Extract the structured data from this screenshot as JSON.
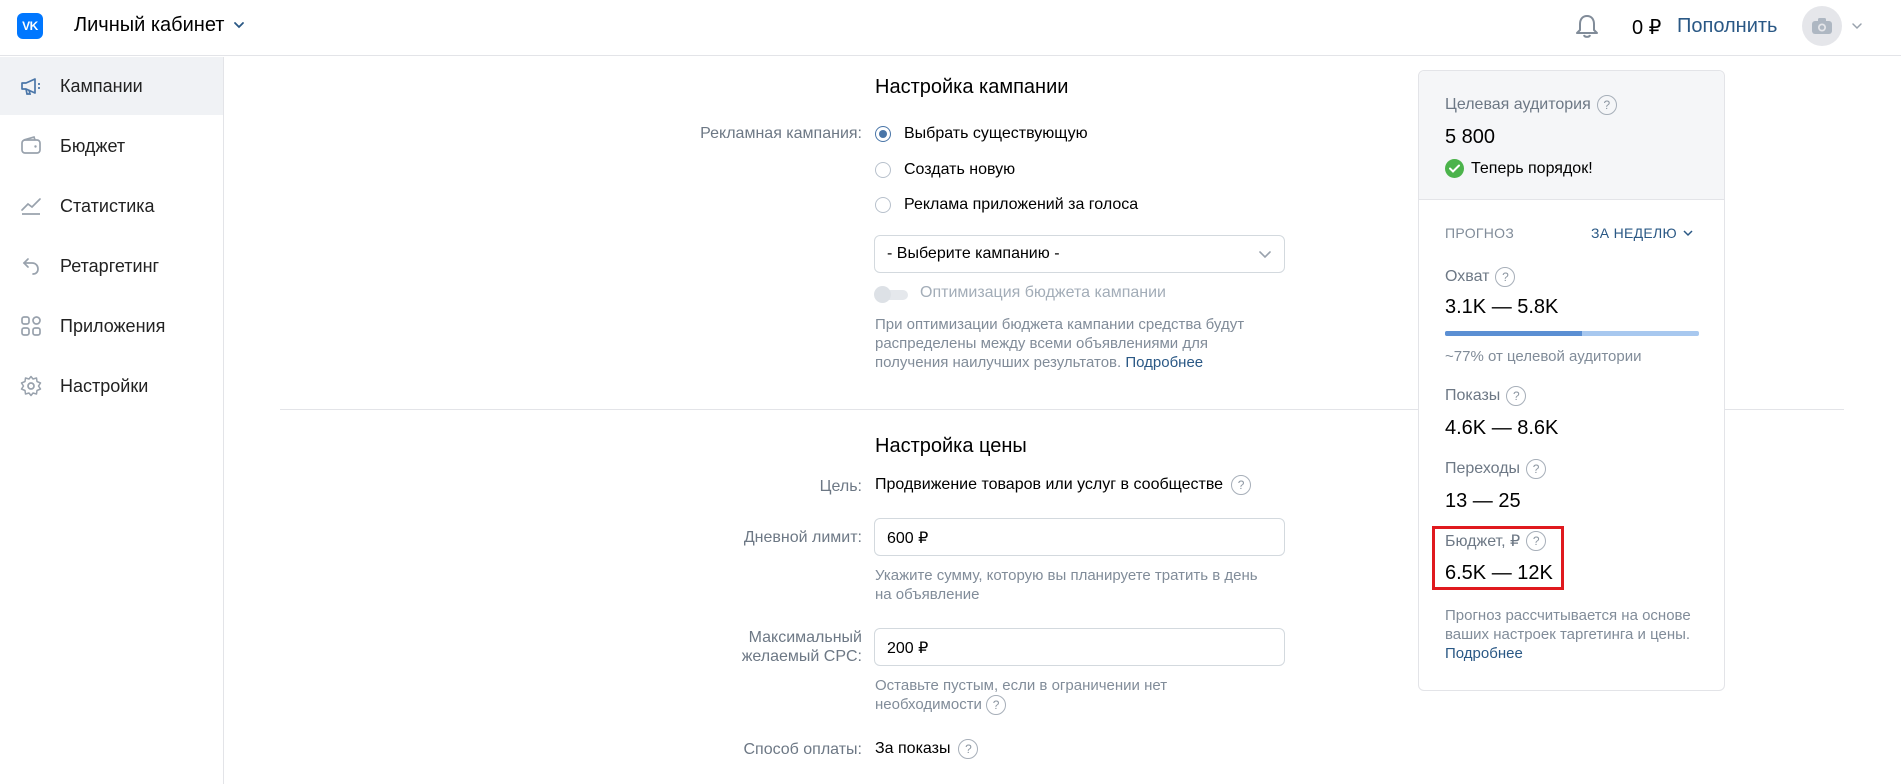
{
  "header": {
    "logo_text": "VK",
    "title": "Личный кабинет",
    "balance": "0 ₽",
    "topup_label": "Пополнить",
    "chevron_icon": "chevron-down-icon",
    "bell_icon": "bell-icon",
    "avatar_icon": "camera-icon"
  },
  "sidebar": {
    "items": [
      {
        "label": "Кампании",
        "icon": "megaphone-icon",
        "active": true
      },
      {
        "label": "Бюджет",
        "icon": "wallet-icon",
        "active": false
      },
      {
        "label": "Статистика",
        "icon": "chart-icon",
        "active": false
      },
      {
        "label": "Ретаргетинг",
        "icon": "retarget-icon",
        "active": false
      },
      {
        "label": "Приложения",
        "icon": "apps-icon",
        "active": false
      },
      {
        "label": "Настройки",
        "icon": "gear-icon",
        "active": false
      }
    ]
  },
  "campaign_settings": {
    "title": "Настройка кампании",
    "campaign_label": "Рекламная кампания:",
    "options": [
      {
        "label": "Выбрать существующую",
        "checked": true
      },
      {
        "label": "Создать новую",
        "checked": false
      },
      {
        "label": "Реклама приложений за голоса",
        "checked": false
      }
    ],
    "select_value": "- Выберите кампанию -",
    "optimization_label": "Оптимизация бюджета кампании",
    "optimization_hint": "При оптимизации бюджета кампании средства будут распределены между всеми объявлениями для получения наилучших результатов.",
    "more_link": "Подробнее"
  },
  "price_settings": {
    "title": "Настройка цены",
    "goal_label": "Цель:",
    "goal_value": "Продвижение товаров или услуг в сообществе",
    "daily_limit_label": "Дневной лимит:",
    "daily_limit_value": "600 ₽",
    "daily_limit_hint": "Укажите сумму, которую вы планируете тратить в день на объявление",
    "max_cpc_label_1": "Максимальный",
    "max_cpc_label_2": "желаемый CPC:",
    "max_cpc_value": "200 ₽",
    "max_cpc_hint": "Оставьте пустым, если в ограничении нет необходимости",
    "payment_label": "Способ оплаты:",
    "payment_value": "За показы"
  },
  "forecast": {
    "audience_label": "Целевая аудитория",
    "audience_value": "5 800",
    "status_text": "Теперь порядок!",
    "forecast_heading": "ПРОГНОЗ",
    "period": "ЗА НЕДЕЛЮ",
    "reach_label": "Охват",
    "reach_value": "3.1K — 5.8K",
    "reach_fill_fraction": 0.54,
    "reach_hint": "~77% от целевой аудитории",
    "impressions_label": "Показы",
    "impressions_value": "4.6K — 8.6K",
    "clicks_label": "Переходы",
    "clicks_value": "13 — 25",
    "budget_label": "Бюджет, ₽",
    "budget_value": "6.5K — 12K",
    "footer_hint": "Прогноз рассчитывается на основе ваших настроек таргетинга и цены.",
    "footer_link": "Подробнее",
    "highlight_color": "#e0191e"
  }
}
